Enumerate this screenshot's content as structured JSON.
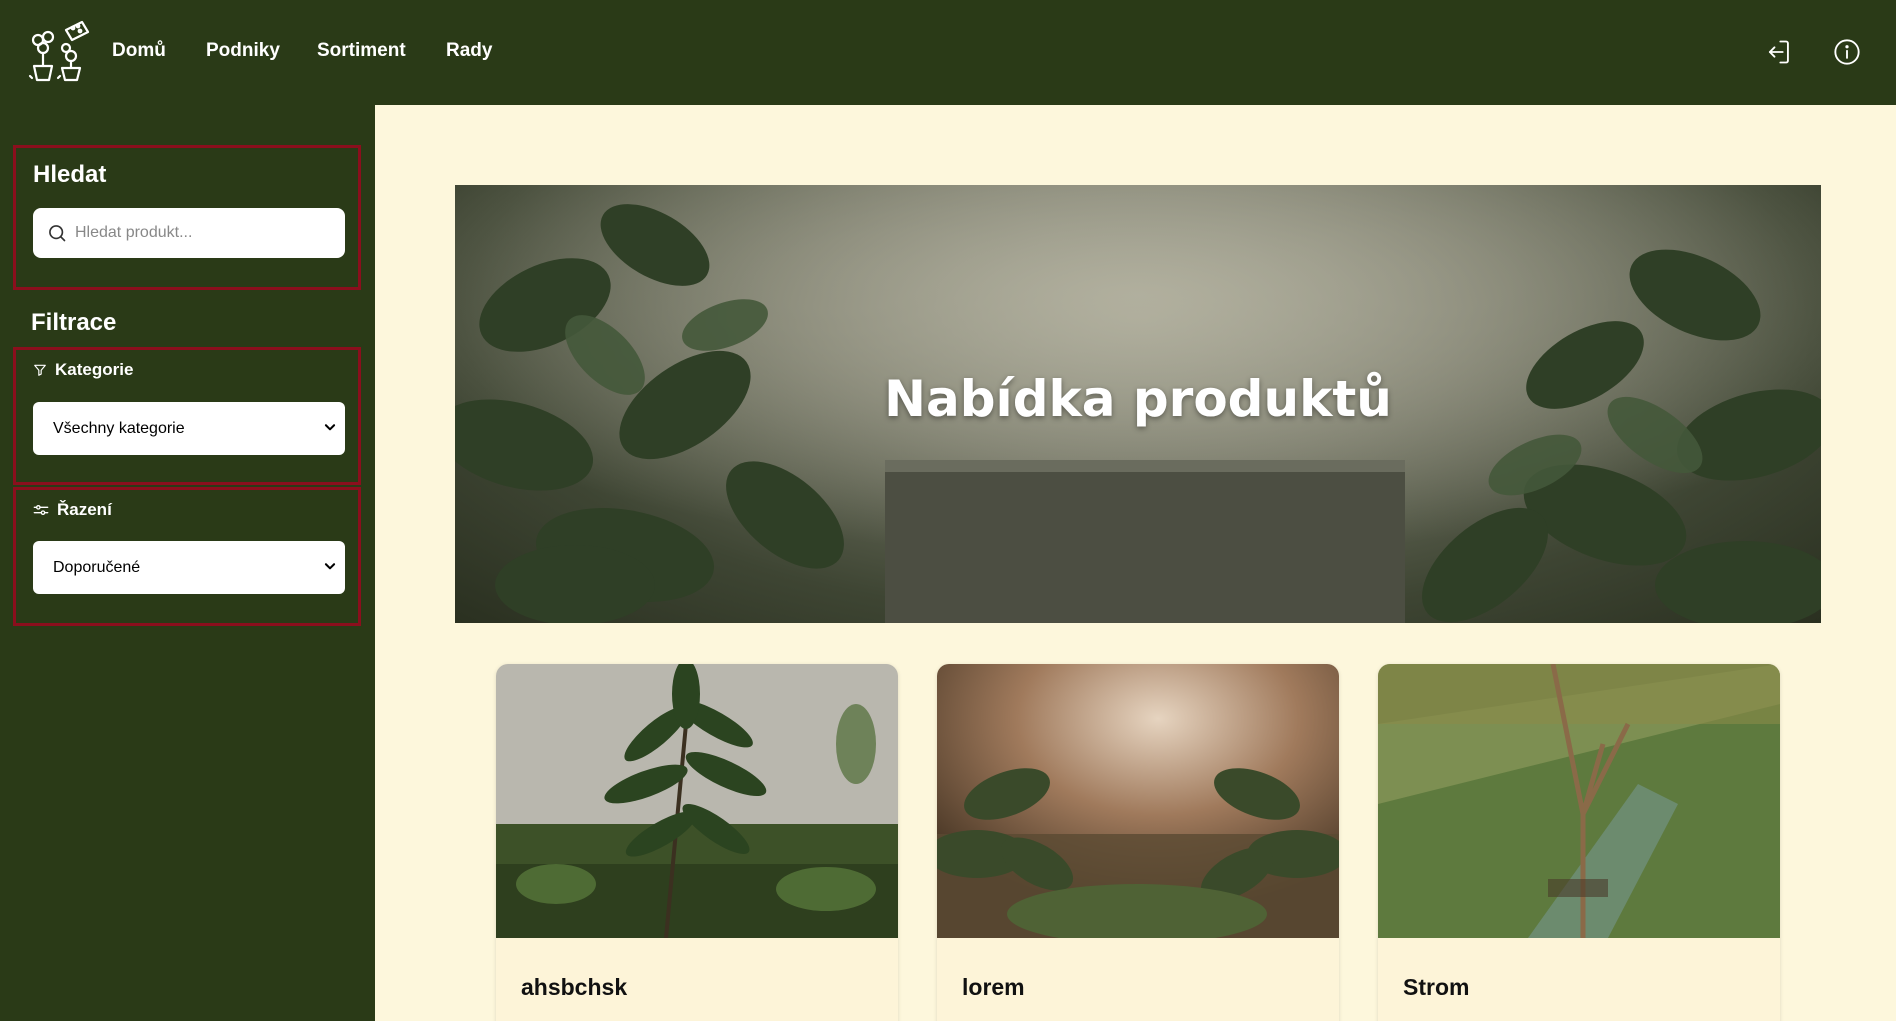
{
  "nav": {
    "logo_icon": "plant-pots-logo-icon",
    "links": [
      "Domů",
      "Podniky",
      "Sortiment",
      "Rady"
    ],
    "logout_icon": "logout-icon",
    "info_icon": "info-icon"
  },
  "sidebar": {
    "search_heading": "Hledat",
    "search_placeholder": "Hledat produkt...",
    "filter_heading": "Filtrace",
    "category_label": "Kategorie",
    "category_value": "Všechny kategorie",
    "sort_label": "Řazení",
    "sort_value": "Doporučené"
  },
  "hero": {
    "title": "Nabídka produktů"
  },
  "products": [
    {
      "name": "ahsbchsk"
    },
    {
      "name": "lorem"
    },
    {
      "name": "Strom"
    }
  ],
  "colors": {
    "dark_green": "#2a3a17",
    "cream": "#fdf7dc",
    "highlight_border": "#8b0f1d"
  }
}
